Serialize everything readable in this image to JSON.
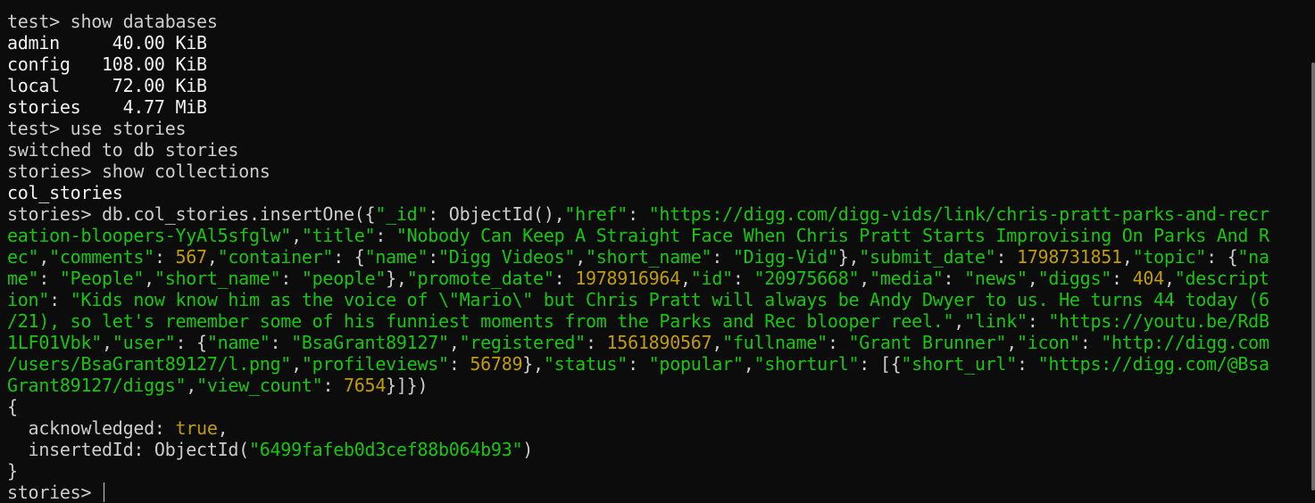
{
  "lines": [
    [
      {
        "t": "test> show databases",
        "c": ""
      }
    ],
    [
      {
        "t": "admin     40.00 KiB",
        "c": "w"
      }
    ],
    [
      {
        "t": "config   108.00 KiB",
        "c": "w"
      }
    ],
    [
      {
        "t": "local     72.00 KiB",
        "c": "w"
      }
    ],
    [
      {
        "t": "stories    4.77 MiB",
        "c": "w"
      }
    ],
    [
      {
        "t": "test> use stories",
        "c": ""
      }
    ],
    [
      {
        "t": "switched to db stories",
        "c": ""
      }
    ],
    [
      {
        "t": "stories> show collections",
        "c": ""
      }
    ],
    [
      {
        "t": "col_stories",
        "c": "w"
      }
    ],
    [
      {
        "t": "stories> db.col_stories.insertOne({",
        "c": ""
      },
      {
        "t": "\"_id\"",
        "c": "g"
      },
      {
        "t": ": ObjectId(),",
        "c": ""
      },
      {
        "t": "\"href\"",
        "c": "g"
      },
      {
        "t": ": ",
        "c": ""
      },
      {
        "t": "\"https://digg.com/digg-vids/link/chris-pratt-parks-and-recr",
        "c": "g"
      }
    ],
    [
      {
        "t": "eation-bloopers-YyAl5sfglw\"",
        "c": "g"
      },
      {
        "t": ",",
        "c": ""
      },
      {
        "t": "\"title\"",
        "c": "g"
      },
      {
        "t": ": ",
        "c": ""
      },
      {
        "t": "\"Nobody Can Keep A Straight Face When Chris Pratt Starts Improvising On Parks And R",
        "c": "g"
      }
    ],
    [
      {
        "t": "ec\"",
        "c": "g"
      },
      {
        "t": ",",
        "c": ""
      },
      {
        "t": "\"comments\"",
        "c": "g"
      },
      {
        "t": ": ",
        "c": ""
      },
      {
        "t": "567",
        "c": "y"
      },
      {
        "t": ",",
        "c": ""
      },
      {
        "t": "\"container\"",
        "c": "g"
      },
      {
        "t": ": {",
        "c": ""
      },
      {
        "t": "\"name\"",
        "c": "g"
      },
      {
        "t": ":",
        "c": ""
      },
      {
        "t": "\"Digg Videos\"",
        "c": "g"
      },
      {
        "t": ",",
        "c": ""
      },
      {
        "t": "\"short_name\"",
        "c": "g"
      },
      {
        "t": ": ",
        "c": ""
      },
      {
        "t": "\"Digg-Vid\"",
        "c": "g"
      },
      {
        "t": "},",
        "c": ""
      },
      {
        "t": "\"submit_date\"",
        "c": "g"
      },
      {
        "t": ": ",
        "c": ""
      },
      {
        "t": "1798731851",
        "c": "y"
      },
      {
        "t": ",",
        "c": ""
      },
      {
        "t": "\"topic\"",
        "c": "g"
      },
      {
        "t": ": {",
        "c": ""
      },
      {
        "t": "\"na",
        "c": "g"
      }
    ],
    [
      {
        "t": "me\"",
        "c": "g"
      },
      {
        "t": ": ",
        "c": ""
      },
      {
        "t": "\"People\"",
        "c": "g"
      },
      {
        "t": ",",
        "c": ""
      },
      {
        "t": "\"short_name\"",
        "c": "g"
      },
      {
        "t": ": ",
        "c": ""
      },
      {
        "t": "\"people\"",
        "c": "g"
      },
      {
        "t": "},",
        "c": ""
      },
      {
        "t": "\"promote_date\"",
        "c": "g"
      },
      {
        "t": ": ",
        "c": ""
      },
      {
        "t": "1978916964",
        "c": "y"
      },
      {
        "t": ",",
        "c": ""
      },
      {
        "t": "\"id\"",
        "c": "g"
      },
      {
        "t": ": ",
        "c": ""
      },
      {
        "t": "\"20975668\"",
        "c": "g"
      },
      {
        "t": ",",
        "c": ""
      },
      {
        "t": "\"media\"",
        "c": "g"
      },
      {
        "t": ": ",
        "c": ""
      },
      {
        "t": "\"news\"",
        "c": "g"
      },
      {
        "t": ",",
        "c": ""
      },
      {
        "t": "\"diggs\"",
        "c": "g"
      },
      {
        "t": ": ",
        "c": ""
      },
      {
        "t": "404",
        "c": "y"
      },
      {
        "t": ",",
        "c": ""
      },
      {
        "t": "\"descript",
        "c": "g"
      }
    ],
    [
      {
        "t": "ion\"",
        "c": "g"
      },
      {
        "t": ": ",
        "c": ""
      },
      {
        "t": "\"Kids now know him as the voice of \\\"Mario\\\" but Chris Pratt will always be Andy Dwyer to us. He turns 44 today (6",
        "c": "g"
      }
    ],
    [
      {
        "t": "/21), so let's remember some of his funniest moments from the Parks and Rec blooper reel.\"",
        "c": "g"
      },
      {
        "t": ",",
        "c": ""
      },
      {
        "t": "\"link\"",
        "c": "g"
      },
      {
        "t": ": ",
        "c": ""
      },
      {
        "t": "\"https://youtu.be/RdB",
        "c": "g"
      }
    ],
    [
      {
        "t": "1LF01Vbk\"",
        "c": "g"
      },
      {
        "t": ",",
        "c": ""
      },
      {
        "t": "\"user\"",
        "c": "g"
      },
      {
        "t": ": {",
        "c": ""
      },
      {
        "t": "\"name\"",
        "c": "g"
      },
      {
        "t": ": ",
        "c": ""
      },
      {
        "t": "\"BsaGrant89127\"",
        "c": "g"
      },
      {
        "t": ",",
        "c": ""
      },
      {
        "t": "\"registered\"",
        "c": "g"
      },
      {
        "t": ": ",
        "c": ""
      },
      {
        "t": "1561890567",
        "c": "y"
      },
      {
        "t": ",",
        "c": ""
      },
      {
        "t": "\"fullname\"",
        "c": "g"
      },
      {
        "t": ": ",
        "c": ""
      },
      {
        "t": "\"Grant Brunner\"",
        "c": "g"
      },
      {
        "t": ",",
        "c": ""
      },
      {
        "t": "\"icon\"",
        "c": "g"
      },
      {
        "t": ": ",
        "c": ""
      },
      {
        "t": "\"http://digg.com",
        "c": "g"
      }
    ],
    [
      {
        "t": "/users/BsaGrant89127/l.png\"",
        "c": "g"
      },
      {
        "t": ",",
        "c": ""
      },
      {
        "t": "\"profileviews\"",
        "c": "g"
      },
      {
        "t": ": ",
        "c": ""
      },
      {
        "t": "56789",
        "c": "y"
      },
      {
        "t": "},",
        "c": ""
      },
      {
        "t": "\"status\"",
        "c": "g"
      },
      {
        "t": ": ",
        "c": ""
      },
      {
        "t": "\"popular\"",
        "c": "g"
      },
      {
        "t": ",",
        "c": ""
      },
      {
        "t": "\"shorturl\"",
        "c": "g"
      },
      {
        "t": ": [{",
        "c": ""
      },
      {
        "t": "\"short_url\"",
        "c": "g"
      },
      {
        "t": ": ",
        "c": ""
      },
      {
        "t": "\"https://digg.com/@Bsa",
        "c": "g"
      }
    ],
    [
      {
        "t": "Grant89127/diggs\"",
        "c": "g"
      },
      {
        "t": ",",
        "c": ""
      },
      {
        "t": "\"view_count\"",
        "c": "g"
      },
      {
        "t": ": ",
        "c": ""
      },
      {
        "t": "7654",
        "c": "y"
      },
      {
        "t": "}]})",
        "c": ""
      }
    ],
    [
      {
        "t": "{",
        "c": ""
      }
    ],
    [
      {
        "t": "  acknowledged: ",
        "c": ""
      },
      {
        "t": "true",
        "c": "y"
      },
      {
        "t": ",",
        "c": ""
      }
    ],
    [
      {
        "t": "  insertedId: ObjectId(",
        "c": ""
      },
      {
        "t": "\"6499fafeb0d3cef88b064b93\"",
        "c": "g"
      },
      {
        "t": ")",
        "c": ""
      }
    ],
    [
      {
        "t": "}",
        "c": ""
      }
    ]
  ],
  "prompt": "stories> ",
  "colors": {
    "background": "#0c0c0c",
    "foreground": "#cccccc",
    "string": "#16c60c",
    "number": "#c19c00",
    "bright": "#f2f2f2"
  }
}
